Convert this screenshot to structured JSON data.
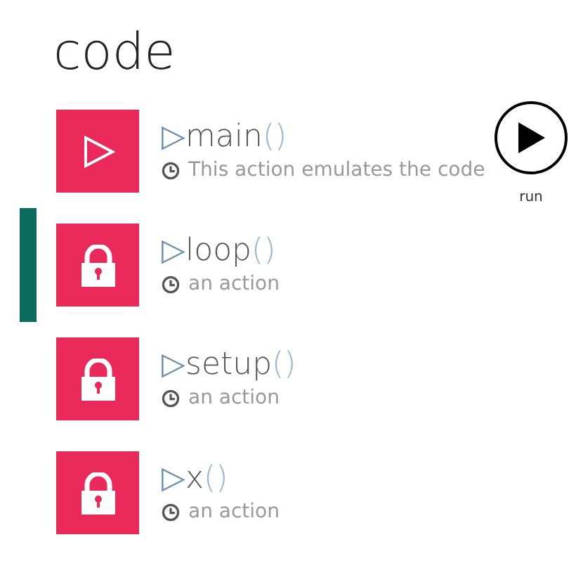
{
  "title": "code",
  "actions": [
    {
      "marker": "▷",
      "name": "main",
      "parens": "()",
      "description": "This action emulates the code",
      "kind": "play",
      "selected": false
    },
    {
      "marker": "▷",
      "name": "loop",
      "parens": "()",
      "description": "an action",
      "kind": "lock",
      "selected": true
    },
    {
      "marker": "▷",
      "name": "setup",
      "parens": "()",
      "description": "an action",
      "kind": "lock",
      "selected": false
    },
    {
      "marker": "▷",
      "name": "x",
      "parens": "()",
      "description": "an action",
      "kind": "lock",
      "selected": false
    }
  ],
  "run_button": {
    "label": "run"
  }
}
